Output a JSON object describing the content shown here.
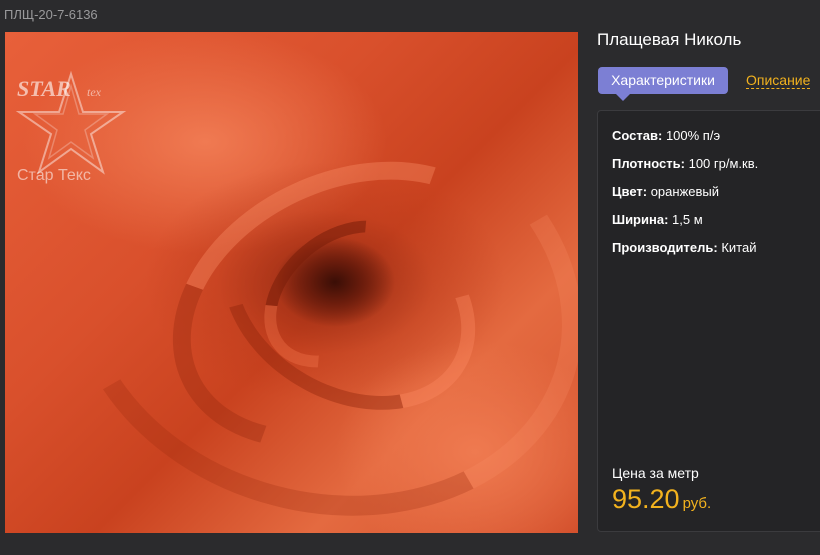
{
  "sku": "ПЛЩ-20-7-6136",
  "product": {
    "title": "Плащевая Николь",
    "image_alt": "оранжевая плащевая ткань"
  },
  "logo": {
    "brand_latin": "STAR",
    "brand_suffix": "tex",
    "brand_cyrillic": "Стар Текс"
  },
  "tabs": [
    {
      "label": "Характеристики",
      "active": true
    },
    {
      "label": "Описание",
      "active": false
    }
  ],
  "specs": [
    {
      "key": "Состав:",
      "value": "100% п/э"
    },
    {
      "key": "Плотность:",
      "value": "100 гр/м.кв."
    },
    {
      "key": "Цвет:",
      "value": "оранжевый"
    },
    {
      "key": "Ширина:",
      "value": "1,5 м"
    },
    {
      "key": "Производитель:",
      "value": "Китай"
    }
  ],
  "price": {
    "label": "Цена за метр",
    "value": "95.20",
    "currency": "руб."
  },
  "colors": {
    "background": "#2b2b2d",
    "accent_tab": "#7c7fd4",
    "price": "#f2b21e",
    "fabric": "#e05a34"
  }
}
